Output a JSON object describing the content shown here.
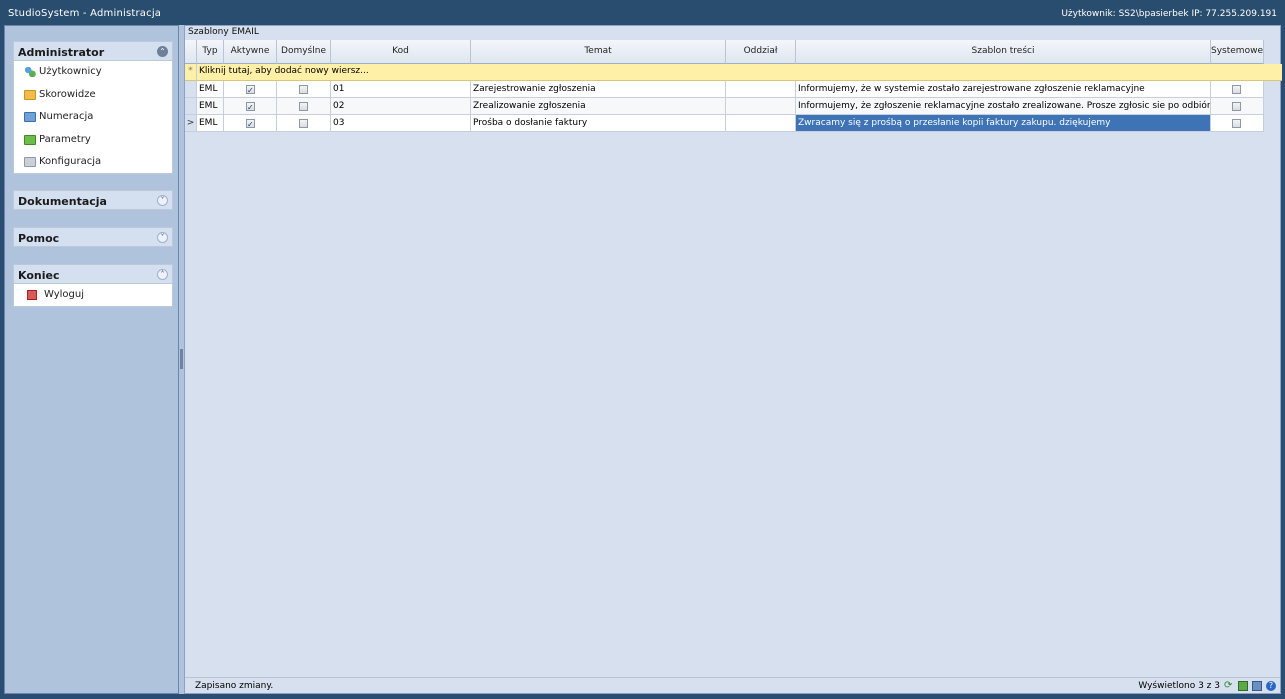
{
  "window": {
    "title": "StudioSystem - Administracja",
    "user_info": "Użytkownik: SS2\\bpasierbek IP: 77.255.209.191"
  },
  "sidebar": {
    "administrator": {
      "title": "Administrator",
      "toggle": "⌃",
      "items": [
        {
          "label": "Użytkownicy",
          "icon": "users-icon"
        },
        {
          "label": "Skorowidze",
          "icon": "folder-orange-icon"
        },
        {
          "label": "Numeracja",
          "icon": "folder-blue-icon"
        },
        {
          "label": "Parametry",
          "icon": "folder-green-icon"
        },
        {
          "label": "Konfiguracja",
          "icon": "folder-gray-icon"
        }
      ]
    },
    "dokumentacja": {
      "title": "Dokumentacja",
      "toggle": "˅"
    },
    "pomoc": {
      "title": "Pomoc",
      "toggle": "˅"
    },
    "koniec": {
      "title": "Koniec",
      "toggle": "˄",
      "items": [
        {
          "label": "Wyloguj",
          "icon": "logout-icon"
        }
      ]
    }
  },
  "main": {
    "caption": "Szablony EMAIL",
    "columns": [
      "Typ",
      "Aktywne",
      "Domyślne",
      "Kod",
      "Temat",
      "Oddział",
      "Szablon treści",
      "Systemowe"
    ],
    "new_row_text": "Kliknij tutaj, aby dodać nowy wiersz...",
    "new_row_marker": "*",
    "current_row_marker": ">",
    "rows": [
      {
        "typ": "EML",
        "aktywne": true,
        "domyslne": false,
        "kod": "01",
        "temat": "Zarejestrowanie zgłoszenia",
        "oddzial": "",
        "szablon": "Informujemy, że w systemie zostało zarejestrowane zgłoszenie reklamacyjne",
        "systemowe": false
      },
      {
        "typ": "EML",
        "aktywne": true,
        "domyslne": false,
        "kod": "02",
        "temat": "Zrealizowanie zgłoszenia",
        "oddzial": "",
        "szablon": "Informujemy, że zgłoszenie reklamacyjne zostało zrealizowane. Prosze zgłosic sie po odbiór produktu.",
        "systemowe": false
      },
      {
        "typ": "EML",
        "aktywne": true,
        "domyslne": false,
        "kod": "03",
        "temat": "Prośba o dosłanie faktury",
        "oddzial": "",
        "szablon": "Zwracamy się z prośbą o przesłanie kopii faktury zakupu. dziękujemy",
        "systemowe": false
      }
    ],
    "status_message": "Zapisano zmiany.",
    "record_count": "Wyświetlono 3 z 3",
    "help_glyph": "?",
    "refresh_glyph": "⟳"
  },
  "colors": {
    "titlebar": "#294d6f",
    "selection": "#3e73b6",
    "new_row": "#fff0a8",
    "panel": "#afc3dc"
  }
}
